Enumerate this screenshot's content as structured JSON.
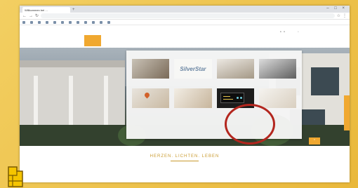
{
  "browser": {
    "tab_label": "Willkommen bei ...",
    "new_tab_label": "+",
    "window_controls": "– □ ×",
    "url": "",
    "bookmarks": [
      {
        "label": ""
      },
      {
        "label": ""
      },
      {
        "label": ""
      },
      {
        "label": ""
      },
      {
        "label": ""
      },
      {
        "label": ""
      },
      {
        "label": ""
      },
      {
        "label": ""
      },
      {
        "label": ""
      },
      {
        "label": ""
      },
      {
        "label": ""
      },
      {
        "label": ""
      }
    ]
  },
  "site": {
    "logo_text": "",
    "utility_links": [
      "",
      "",
      "",
      "",
      ""
    ],
    "main_nav": [
      "",
      "",
      "",
      "",
      ""
    ],
    "active_nav_index": 4,
    "dropdown_cards": [
      {
        "title": "",
        "thumb_icon": "phone-handset-photo"
      },
      {
        "title": "",
        "thumb_icon": "silverstar-logo",
        "brand": "SilverStar"
      },
      {
        "title": "",
        "thumb_icon": "writing-hand-photo"
      },
      {
        "title": "",
        "thumb_icon": "calculator-photo"
      },
      {
        "title": "",
        "thumb_icon": "map-pin-photo"
      },
      {
        "title": "",
        "thumb_icon": "handshake-photo"
      },
      {
        "title": "",
        "thumb_icon": "control-panel-display"
      },
      {
        "title": "",
        "thumb_icon": "pen-document-photo"
      }
    ],
    "highlighted_card_index": 6,
    "tagline": "HERZEN. LICHTEN. LEBEN",
    "description": "",
    "accent_color": "#f0a830",
    "highlight_color": "#b3261e"
  }
}
